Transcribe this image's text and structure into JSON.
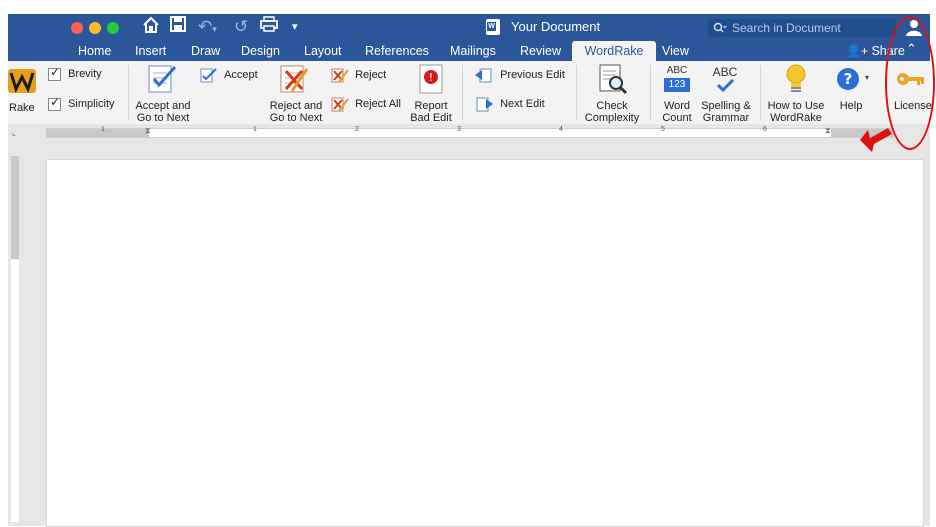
{
  "window": {
    "document_title": "Your Document",
    "search_placeholder": "Search in Document"
  },
  "tabs": [
    "Home",
    "Insert",
    "Draw",
    "Design",
    "Layout",
    "References",
    "Mailings",
    "Review",
    "WordRake",
    "View"
  ],
  "active_tab": "WordRake",
  "share_label": "Share",
  "ribbon": {
    "rake_label": "Rake",
    "brevity_label": "Brevity",
    "simplicity_label": "Simplicity",
    "accept_go_next": [
      "Accept and",
      "Go to Next"
    ],
    "accept_label": "Accept",
    "reject_go_next": [
      "Reject and",
      "Go to Next"
    ],
    "reject_label": "Reject",
    "reject_all_label": "Reject All",
    "report_bad_edit": [
      "Report",
      "Bad Edit"
    ],
    "previous_edit_label": "Previous Edit",
    "next_edit_label": "Next Edit",
    "check_complexity": [
      "Check",
      "Complexity"
    ],
    "word_count": [
      "Word",
      "Count"
    ],
    "spelling_grammar": [
      "Spelling &",
      "Grammar"
    ],
    "how_to_use": [
      "How to Use",
      "WordRake"
    ],
    "help_label": "Help",
    "license_label": "License",
    "abc_text": "ABC",
    "abc_num": "123"
  },
  "ruler": {
    "numbers": [
      "1",
      "1",
      "2",
      "3",
      "4",
      "5",
      "6"
    ]
  },
  "colors": {
    "word_blue": "#2b579a",
    "annotation_red": "#e01010"
  }
}
